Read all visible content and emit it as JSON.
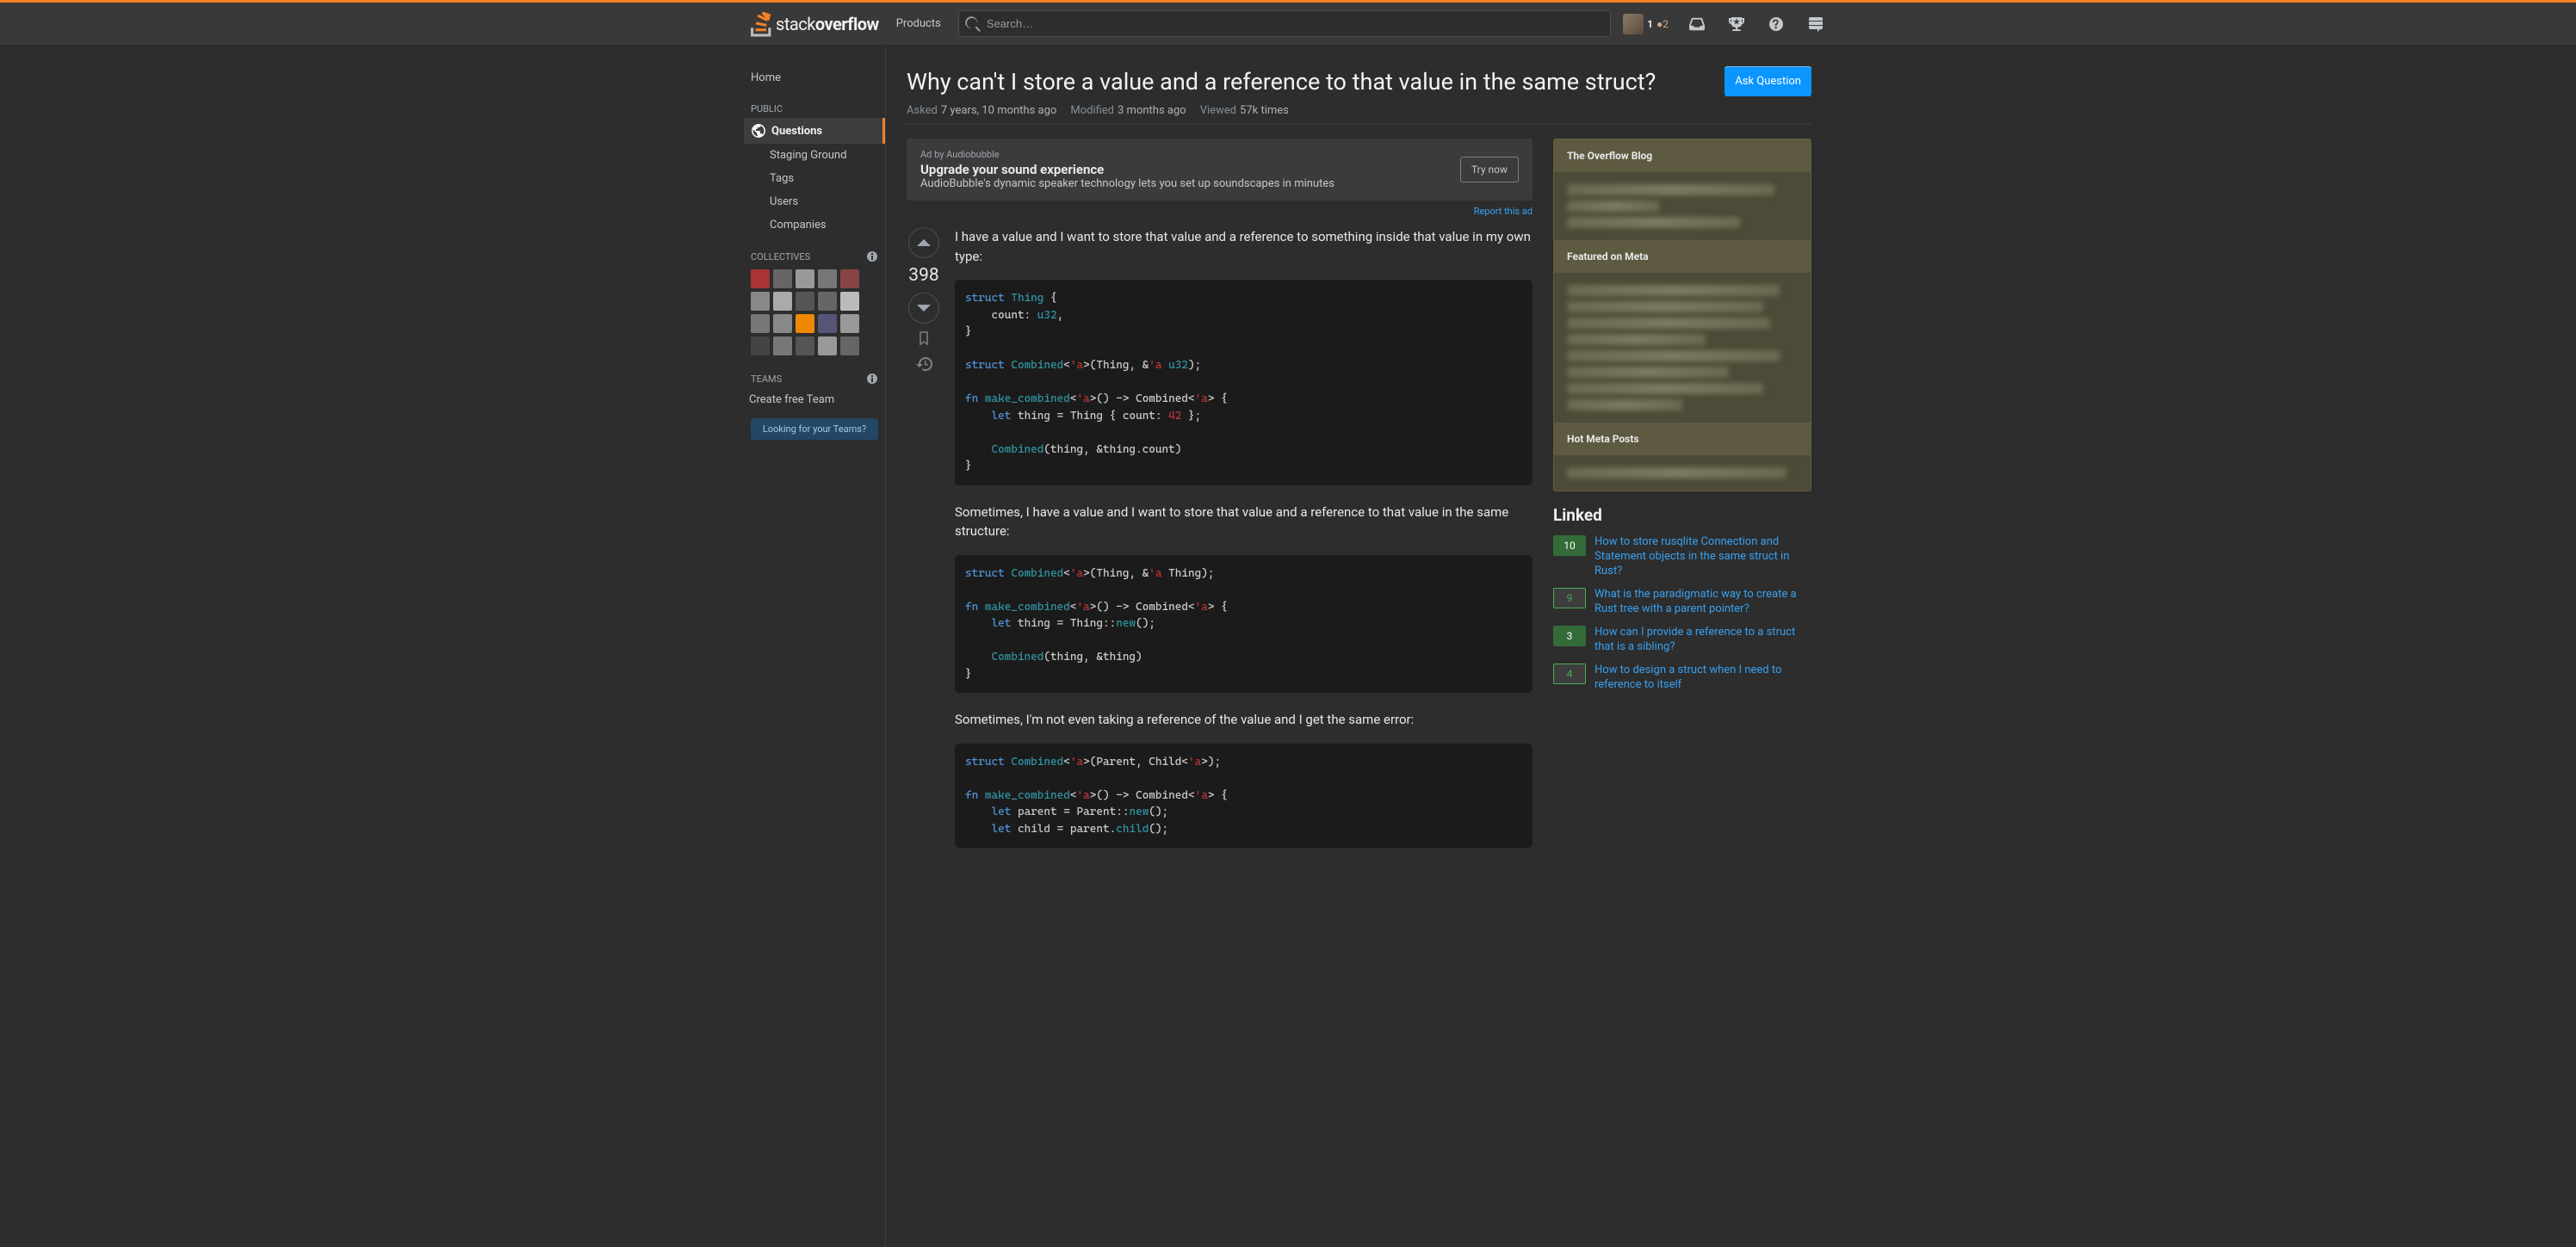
{
  "topbar": {
    "logo_stack": "stack",
    "logo_overflow": "overflow",
    "products": "Products",
    "search_placeholder": "Search…",
    "rep": "1",
    "bronze": "2"
  },
  "sidebar": {
    "home": "Home",
    "public": "PUBLIC",
    "questions": "Questions",
    "staging": "Staging Ground",
    "tags": "Tags",
    "users": "Users",
    "companies": "Companies",
    "collectives": "COLLECTIVES",
    "teams": "TEAMS",
    "create_team": "Create free Team",
    "looking": "Looking for your Teams?"
  },
  "question": {
    "title": "Why can't I store a value and a reference to that value in the same struct?",
    "ask": "Ask Question",
    "asked_label": "Asked",
    "asked": "7 years, 10 months ago",
    "modified_label": "Modified",
    "modified": "3 months ago",
    "viewed_label": "Viewed",
    "viewed": "57k times",
    "score": "398"
  },
  "ad": {
    "by": "Ad by Audiobubble",
    "headline": "Upgrade your sound experience",
    "sub": "AudioBubble's dynamic speaker technology lets you set up soundscapes in minutes",
    "cta": "Try now",
    "report": "Report this ad"
  },
  "body": {
    "p1": "I have a value and I want to store that value and a reference to something inside that value in my own type:",
    "p2": "Sometimes, I have a value and I want to store that value and a reference to that value in the same structure:",
    "p3": "Sometimes, I'm not even taking a reference of the value and I get the same error:"
  },
  "bulletin": {
    "overflow_blog": "The Overflow Blog",
    "featured": "Featured on Meta",
    "hot": "Hot Meta Posts"
  },
  "linked": {
    "title": "Linked",
    "items": [
      {
        "score": "10",
        "answered": true,
        "text": "How to store rusqlite Connection and Statement objects in the same struct in Rust?"
      },
      {
        "score": "9",
        "answered": false,
        "text": "What is the paradigmatic way to create a Rust tree with a parent pointer?"
      },
      {
        "score": "3",
        "answered": true,
        "text": "How can I provide a reference to a struct that is a sibling?"
      },
      {
        "score": "4",
        "answered": false,
        "text": "How to design a struct when I need to reference to itself"
      }
    ]
  }
}
